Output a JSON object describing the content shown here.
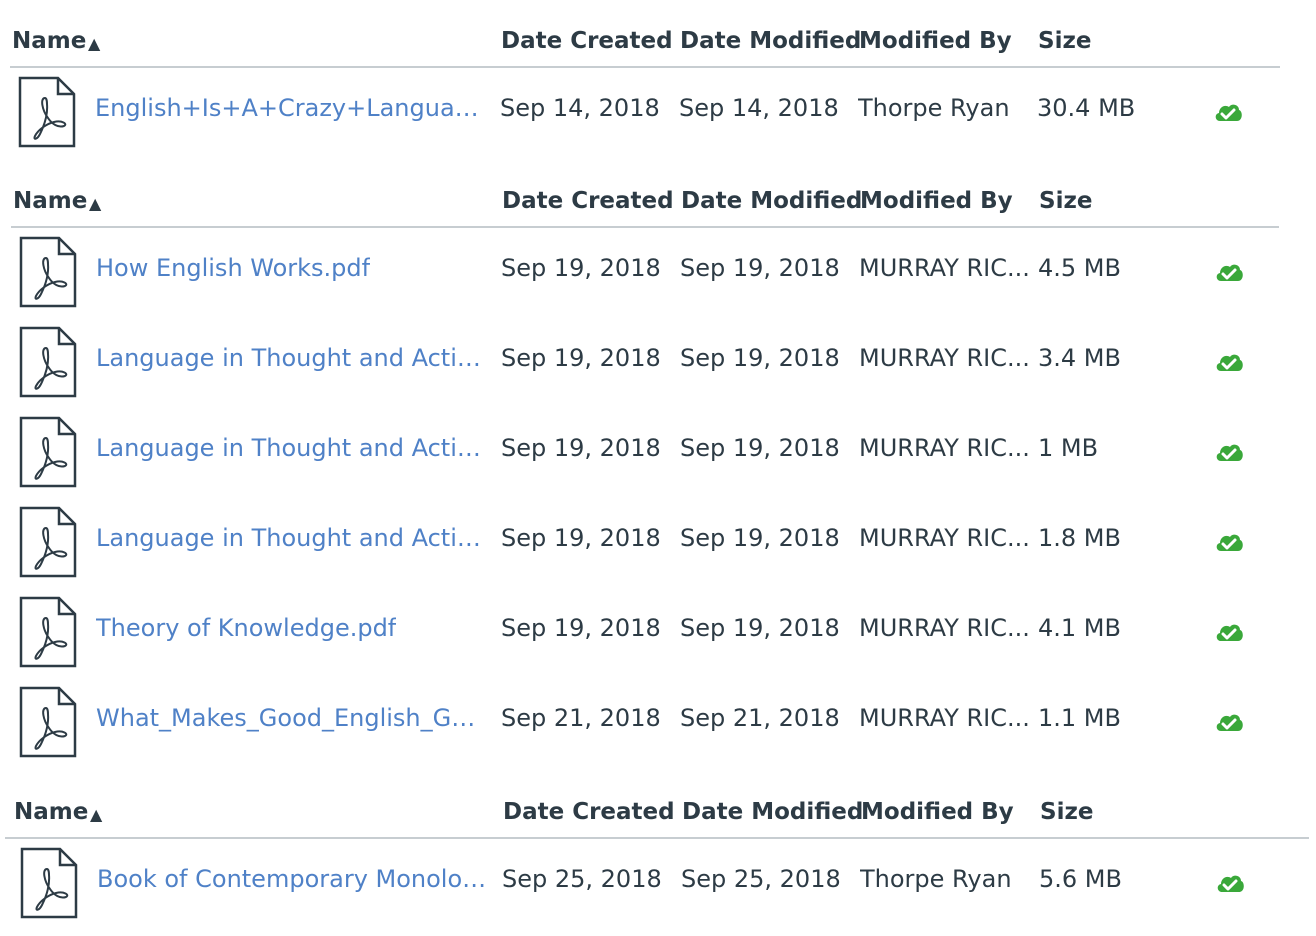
{
  "colors": {
    "link": "#4f81c7",
    "text": "#2d3b45",
    "divider": "#c7cdd1",
    "status_ok": "#3aa83a"
  },
  "header": {
    "name": "Name",
    "date_created": "Date Created",
    "date_modified": "Date Modified",
    "modified_by": "Modified By",
    "size": "Size",
    "sort_icon": "sort-ascending-triangle"
  },
  "groups": [
    {
      "files": [
        {
          "name": "English+Is+A+Crazy+Language+...",
          "date_created": "Sep 14, 2018",
          "date_modified": "Sep 14, 2018",
          "modified_by": "Thorpe Ryan",
          "size": "30.4 MB",
          "icon": "pdf-file-icon",
          "status_icon": "cloud-check-icon"
        }
      ]
    },
    {
      "files": [
        {
          "name": "How English Works.pdf",
          "date_created": "Sep 19, 2018",
          "date_modified": "Sep 19, 2018",
          "modified_by": "MURRAY RIC...",
          "size": "4.5 MB",
          "icon": "pdf-file-icon",
          "status_icon": "cloud-check-icon"
        },
        {
          "name": "Language in Thought and Action...",
          "date_created": "Sep 19, 2018",
          "date_modified": "Sep 19, 2018",
          "modified_by": "MURRAY RIC...",
          "size": "3.4 MB",
          "icon": "pdf-file-icon",
          "status_icon": "cloud-check-icon"
        },
        {
          "name": "Language in Thought and Action...",
          "date_created": "Sep 19, 2018",
          "date_modified": "Sep 19, 2018",
          "modified_by": "MURRAY RIC...",
          "size": "1 MB",
          "icon": "pdf-file-icon",
          "status_icon": "cloud-check-icon"
        },
        {
          "name": "Language in Thought and Action...",
          "date_created": "Sep 19, 2018",
          "date_modified": "Sep 19, 2018",
          "modified_by": "MURRAY RIC...",
          "size": "1.8 MB",
          "icon": "pdf-file-icon",
          "status_icon": "cloud-check-icon"
        },
        {
          "name": "Theory of Knowledge.pdf",
          "date_created": "Sep 19, 2018",
          "date_modified": "Sep 19, 2018",
          "modified_by": "MURRAY RIC...",
          "size": "4.1 MB",
          "icon": "pdf-file-icon",
          "status_icon": "cloud-check-icon"
        },
        {
          "name": "What_Makes_Good_English_Go...",
          "date_created": "Sep 21, 2018",
          "date_modified": "Sep 21, 2018",
          "modified_by": "MURRAY RIC...",
          "size": "1.1 MB",
          "icon": "pdf-file-icon",
          "status_icon": "cloud-check-icon"
        }
      ]
    },
    {
      "files": [
        {
          "name": "Book of Contemporary Monolog...",
          "date_created": "Sep 25, 2018",
          "date_modified": "Sep 25, 2018",
          "modified_by": "Thorpe Ryan",
          "size": "5.6 MB",
          "icon": "pdf-file-icon",
          "status_icon": "cloud-check-icon"
        }
      ]
    }
  ]
}
